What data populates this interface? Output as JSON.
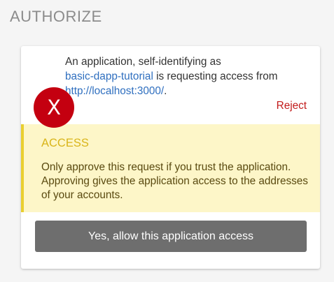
{
  "page": {
    "title": "AUTHORIZE"
  },
  "avatar": {
    "letter": "X",
    "color": "#c40010"
  },
  "request": {
    "line_prefix": "An application, self-identifying as",
    "app_name": "basic-dapp-tutorial",
    "middle": " is requesting access from",
    "origin": "http://localhost:3000/",
    "suffix": "."
  },
  "actions": {
    "reject_label": "Reject",
    "allow_label": "Yes, allow this application access"
  },
  "notice": {
    "title": "ACCESS",
    "body": "Only approve this request if you trust the application. Approving gives the application access to the addresses of your accounts."
  },
  "colors": {
    "link": "#2f6fbf",
    "reject": "#c21a1a",
    "notice_bg": "#fdf6c8",
    "notice_border": "#e9cf2f",
    "button_bg": "#6e6e6e"
  }
}
